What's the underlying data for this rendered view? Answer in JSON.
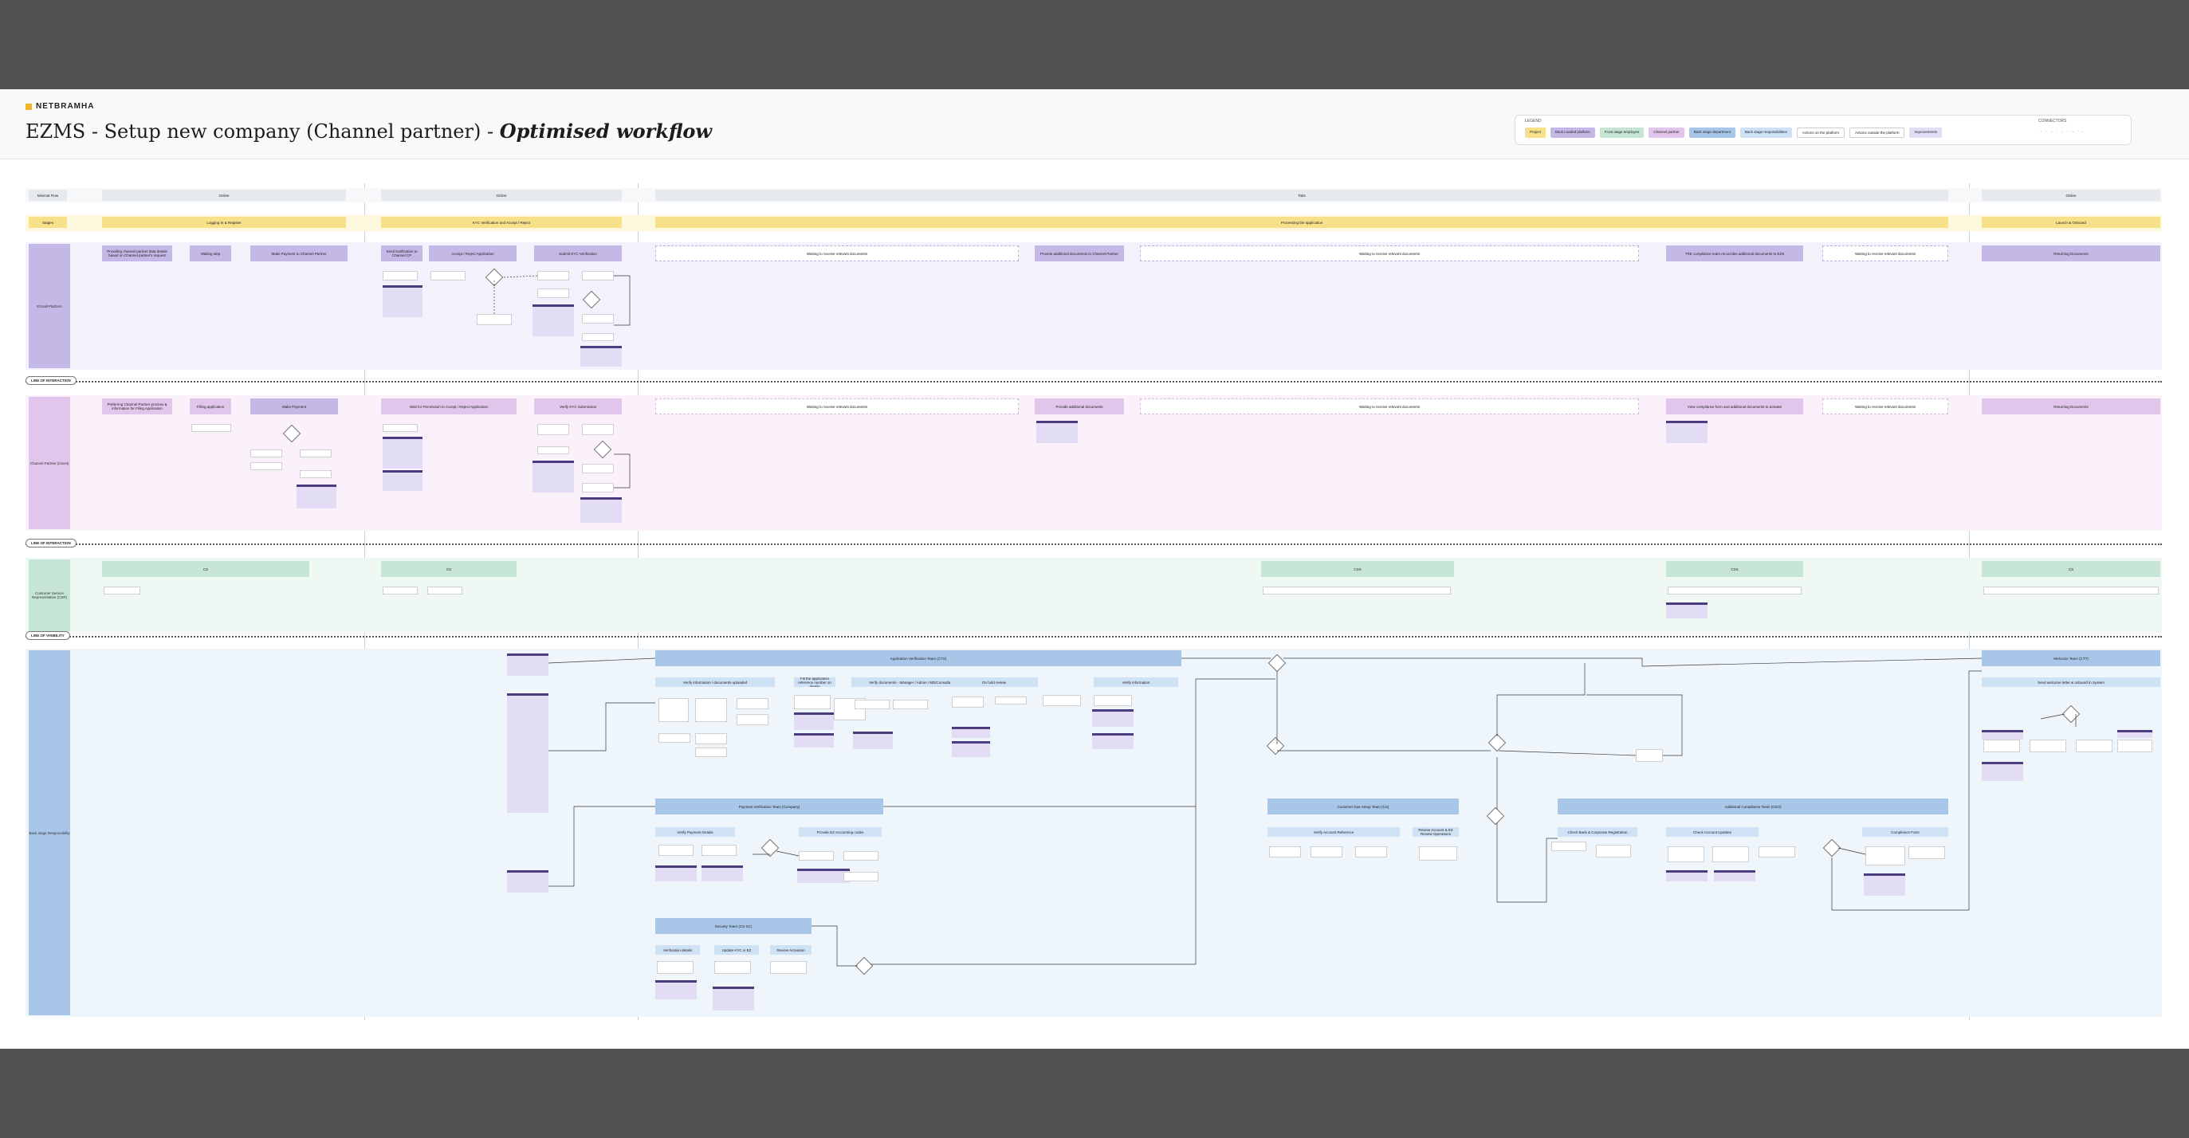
{
  "header": {
    "brand": "NETBRAMHA",
    "title_main": "EZMS - Setup new company (Channel partner) - ",
    "title_italic": "Optimised workflow"
  },
  "legend": {
    "title": "LEGEND",
    "connectors_title": "CONNECTORS",
    "items": [
      {
        "label": "Project",
        "color": "#f6e08a"
      },
      {
        "label": "Back Loaded platform",
        "color": "#c3b8e6"
      },
      {
        "label": "Front stage employee",
        "color": "#c6e5d5"
      },
      {
        "label": "Channel partner",
        "color": "#e2c5ea"
      },
      {
        "label": "Back stage department",
        "color": "#a7c6e8"
      },
      {
        "label": "Back stage responsibilities",
        "color": "#cfe1f5"
      },
      {
        "label": "Actions on the platform",
        "color": "#ffffff"
      },
      {
        "label": "Actions outside the platform",
        "color": "#ffffff"
      },
      {
        "label": "Improvements",
        "color": "#e3dcf5"
      }
    ]
  },
  "phases": {
    "label": "Minimal Flow",
    "items": [
      "Online",
      "Online",
      "Tabs",
      "Online"
    ]
  },
  "stages": {
    "label": "Stages",
    "items": [
      "Logging In & Register",
      "KYC Verification and Accept / Reject",
      "Processing the application",
      "Launch & Onboard"
    ]
  },
  "lanes": {
    "platform": "Ezmall Platform",
    "partner": "Channel Partner (Client)",
    "frontstage": "Customer Service Representative (CSR)",
    "backstage": "Back stage Responsibility"
  },
  "separators": [
    "LINE OF INTERACTION",
    "LINE OF INTERACTION",
    "LINE OF VISIBILITY"
  ],
  "platform_row": [
    "Providing channel partner data details based on Channel partner's request",
    "Waiting step",
    "Make Payment to Channel Partner",
    "Send Notification to Channel CP",
    "Accept / Reject Application",
    "Submit KYC Verification",
    "Waiting to receive relevant documents",
    "Provide additional documents to Channel Partner",
    "Waiting to receive relevant documents",
    "TRE compliance team reconciles additional documents to EZS",
    "Waiting to receive relevant documents",
    "Returning Documents"
  ],
  "partner_row": [
    "Preferring Channel Partner process & information for Filing Application",
    "Filling application",
    "Make Payment",
    "Wait for Permission to Accept / Reject Application",
    "Verify KYC Submission",
    "Waiting to receive relevant documents",
    "Provide additional documents",
    "Waiting to receive relevant documents",
    "View compliance form and additional documents to activate",
    "Waiting to receive relevant documents",
    "Returning Documents"
  ],
  "frontstage_row": [
    "CS",
    "CS",
    "CSS",
    "CSS",
    "CS"
  ],
  "backstage": {
    "departments": [
      "Application Verification Team (CTS)",
      "Payment Verification Team (Company)",
      "Security Team (CS-SC)",
      "Customer Due Setup Team (CS)",
      "Additional Compliance Team (CEO)",
      "Welcome Team (CTT)"
    ],
    "sub": [
      "Verify information / documents uploaded",
      "Fill the application reference number on details",
      "Verify documents - Manager / Admin / MD/Consultant",
      "On hold review",
      "Verify information",
      "Verify Payment Details",
      "Provide EZ Accounting codes",
      "Verification details",
      "Update KYC in EZ",
      "Review Activation",
      "Verify Account Reference",
      "Review Account & EZ Review Operations",
      "Check Bank & Corporate Registration",
      "Check Account Updates",
      "Compliance Form",
      "Verify & Initiated the application of the compliance",
      "Send welcome letter & onboard in System"
    ]
  }
}
